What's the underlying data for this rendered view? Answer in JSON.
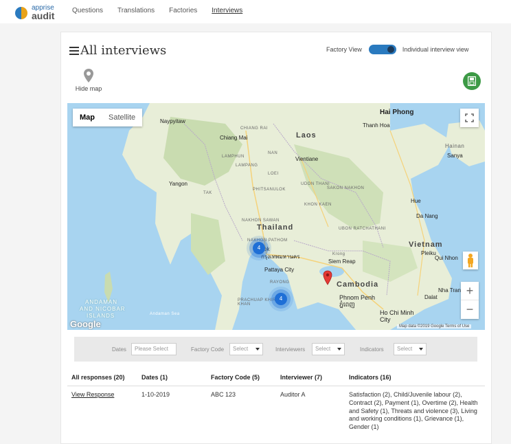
{
  "brand": {
    "line1": "apprise",
    "line2": "audit"
  },
  "nav": {
    "links": [
      "Questions",
      "Translations",
      "Factories",
      "Interviews"
    ],
    "active": "Interviews"
  },
  "page": {
    "title": "All interviews",
    "view_toggle": {
      "left_label": "Factory View",
      "right_label": "Individual interview view",
      "state": "individual"
    },
    "hide_map_label": "Hide map",
    "export_icon": "save-icon"
  },
  "map": {
    "type_buttons": [
      "Map",
      "Satellite"
    ],
    "selected_type": "Map",
    "google_label": "Google",
    "attribution": "Map data ©2019 Google   Terms of Use",
    "countries": [
      "Laos",
      "Thailand",
      "Cambodia",
      "Vietnam"
    ],
    "cities": [
      "Hai Phong",
      "Thanh Hoa",
      "Naypyitaw",
      "Chiang Mai",
      "Vientiane",
      "Yangon",
      "Hainan",
      "Sanya",
      "Bangkok",
      "Pattaya City",
      "Siem Reap",
      "Phnom Penh",
      "Ho Chi Minh City",
      "Da Nang",
      "Hue",
      "Pleiku",
      "Qui Nhon",
      "Nha Trang",
      "Dalat"
    ],
    "city_scripts": {
      "bangkok": "กรุงเทพมหานคร",
      "phnom_penh": "ភ្នំពេញ"
    },
    "city_prefix": "kok",
    "small_labels": [
      "CHIANG RAI",
      "LAMPHUN",
      "LAMPANG",
      "NAN",
      "PHITSANULOK",
      "UDON THANI",
      "SAKON NAKHON",
      "KHON KAEN",
      "NAKHON SAWAN",
      "UBON RATCHATHANI",
      "RAYONG",
      "PRACHUAP KHIRI KHAN",
      "TAK",
      "LOEI",
      "NAKHON PATHOM",
      "Andaman Sea",
      "Krong"
    ],
    "water_labels": [
      "ANDAMAN",
      "AND NICOBAR",
      "ISLANDS"
    ],
    "clusters": [
      {
        "count": "4"
      },
      {
        "count": "4"
      }
    ],
    "marker": "red-pin"
  },
  "filters": {
    "dates_label": "Dates",
    "dates_placeholder": "Please Select",
    "factory_code_label": "Factory Code",
    "factory_code_value": "Select",
    "interviewers_label": "Interviewers",
    "interviewers_value": "Select",
    "indicators_label": "Indicators",
    "indicators_value": "Select"
  },
  "table": {
    "headers": [
      "All responses (20)",
      "Dates (1)",
      "Factory Code (5)",
      "Interviewer (7)",
      "Indicators (16)"
    ],
    "rows": [
      {
        "response": "View Response",
        "date": "1-10-2019",
        "factory_code": "ABC 123",
        "interviewer": "Auditor A",
        "indicators": "Satisfaction (2), Child/Juvenile labour (2), Contract (2), Payment (1), Overtime (2), Health and Safety (1), Threats and violence (3), Living and working conditions (1), Grievance (1), Gender (1)"
      }
    ]
  },
  "colors": {
    "toggle": "#2a7abf",
    "export": "#3d9a46",
    "cluster": "#1f6fd6",
    "water": "#a8d4f0",
    "land": "#e8eed8"
  }
}
